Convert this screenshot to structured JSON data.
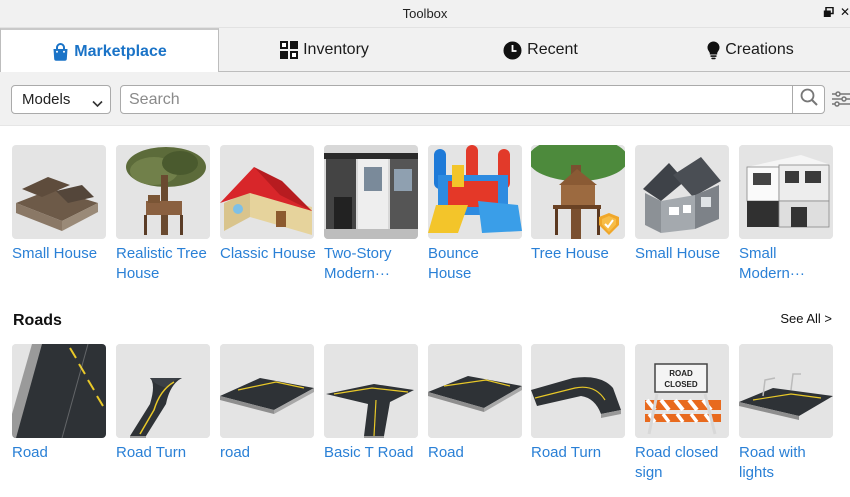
{
  "window": {
    "title": "Toolbox",
    "controls": [
      "restore-icon",
      "close-icon"
    ]
  },
  "tabs": [
    {
      "label": "Marketplace",
      "icon": "shopping-bag-icon",
      "active": true
    },
    {
      "label": "Inventory",
      "icon": "grid-icon",
      "active": false
    },
    {
      "label": "Recent",
      "icon": "clock-icon",
      "active": false
    },
    {
      "label": "Creations",
      "icon": "lightbulb-icon",
      "active": false
    }
  ],
  "search": {
    "category_selected": "Models",
    "placeholder": "Search",
    "value": ""
  },
  "featured": {
    "items": [
      {
        "name": "Small House"
      },
      {
        "name": "Realistic Tree House"
      },
      {
        "name": "Classic House"
      },
      {
        "name": "Two-Story Modern···"
      },
      {
        "name": "Bounce House"
      },
      {
        "name": "Tree House",
        "badge": "verified-creator-badge-icon"
      },
      {
        "name": "Small House"
      },
      {
        "name": "Small Modern···"
      }
    ]
  },
  "roads": {
    "title": "Roads",
    "see_all": "See All >",
    "items": [
      {
        "name": "Road"
      },
      {
        "name": "Road Turn"
      },
      {
        "name": "road"
      },
      {
        "name": "Basic T Road"
      },
      {
        "name": "Road"
      },
      {
        "name": "Road Turn"
      },
      {
        "name": "Road closed sign",
        "sign_text": "ROAD CLOSED"
      },
      {
        "name": "Road with lights"
      }
    ]
  },
  "colors": {
    "accent": "#1a73c7",
    "link": "#2a80d6",
    "panel": "#f1f1f1",
    "thumb_bg": "#e4e4e4"
  }
}
